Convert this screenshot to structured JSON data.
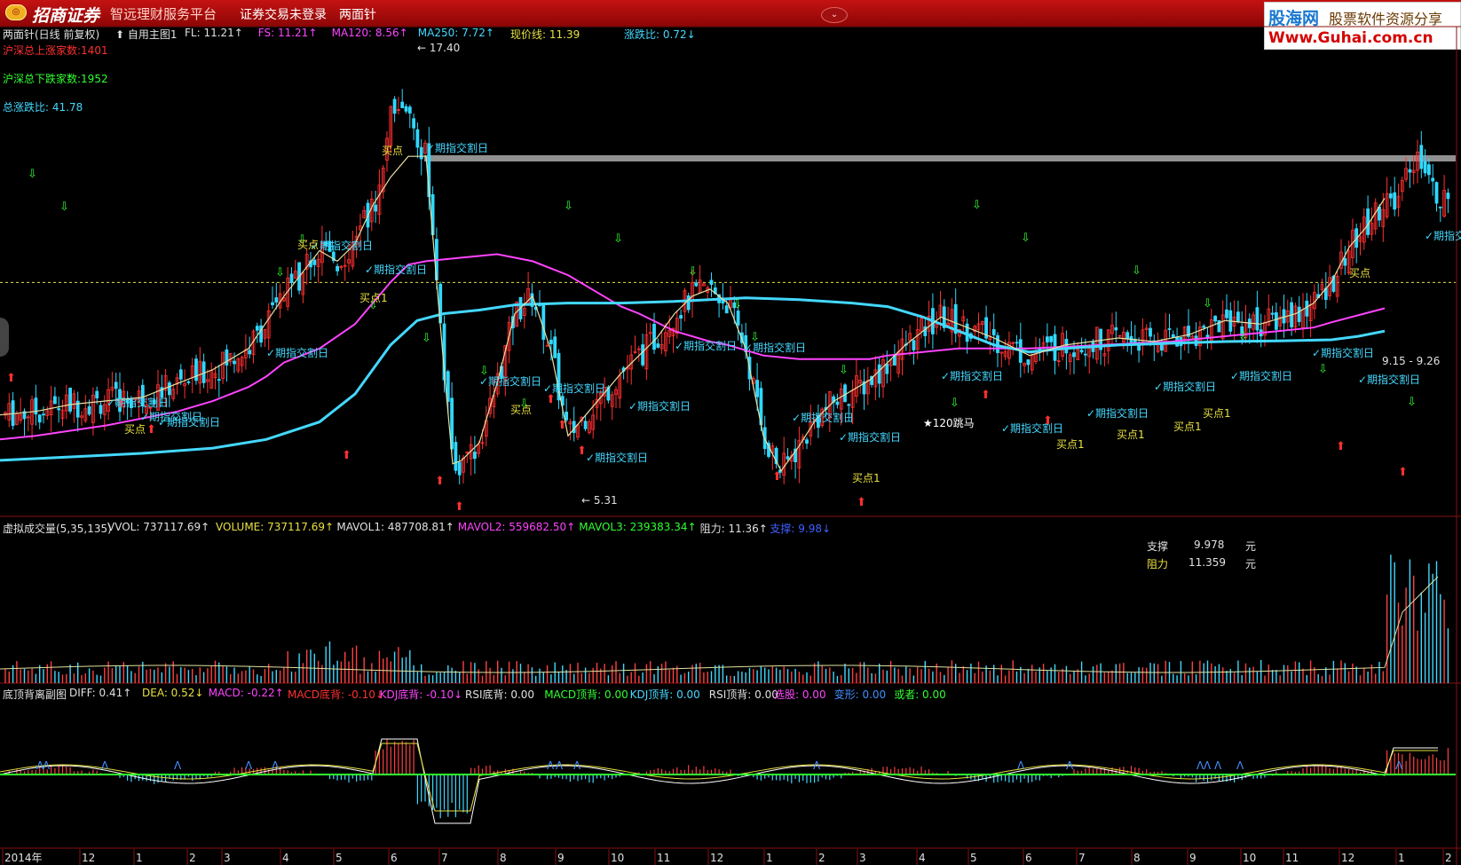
{
  "app": {
    "brand": "招商证券",
    "slogan": "智远理财服务平台",
    "menu": [
      {
        "label": "证券交易未登录"
      },
      {
        "label": "两面针"
      }
    ]
  },
  "ad": {
    "logo": "股海网",
    "slogan": "股票软件资源分享",
    "url": "Www.Guhai.com.cn"
  },
  "main_panel": {
    "title": "两面针(日线 前复权)",
    "template": "自用主图1",
    "indicators": [
      {
        "text": "FL: 11.21",
        "color": "#e0e0e0",
        "arrow": "up"
      },
      {
        "text": "FS: 11.21",
        "color": "#ff44ff",
        "arrow": "up"
      },
      {
        "text": "MA120: 8.56",
        "color": "#ff44ff",
        "arrow": "up"
      },
      {
        "text": "MA250: 7.72",
        "color": "#44d8ff",
        "arrow": "up"
      },
      {
        "text": "现价线: 11.39",
        "color": "#e8e040",
        "arrow": ""
      },
      {
        "text": "涨跌比: 0.72",
        "color": "#44d8ff",
        "arrow": "down"
      }
    ],
    "market_stats": [
      {
        "text": "沪深总上涨家数:1401",
        "color": "#ff3030"
      },
      {
        "text": "沪深总下跌家数:1952",
        "color": "#30ff30"
      },
      {
        "text": "总涨跌比: 41.78",
        "color": "#44d8ff"
      }
    ],
    "annotations": {
      "high_label": "17.40",
      "low_label": "5.31",
      "range_label": "9.15 - 9.26",
      "event_120": "★120跳马",
      "expiry": "期指交割日",
      "buy": "买点",
      "buy1": "买点1"
    }
  },
  "volume_panel": {
    "title": "虚拟成交量(5,35,135)",
    "indicators": [
      {
        "text": "VVOL: 737117.69",
        "color": "#e0e0e0",
        "arrow": "up"
      },
      {
        "text": "VOLUME: 737117.69",
        "color": "#e8e040",
        "arrow": "up"
      },
      {
        "text": "MAVOL1: 487708.81",
        "color": "#e0e0e0",
        "arrow": "up"
      },
      {
        "text": "MAVOL2: 559682.50",
        "color": "#ff44ff",
        "arrow": "up"
      },
      {
        "text": "MAVOL3: 239383.34",
        "color": "#30ff30",
        "arrow": "up"
      },
      {
        "text": "阻力: 11.36",
        "color": "#e0e0e0",
        "arrow": "up"
      },
      {
        "text": "支撑: 9.98",
        "color": "#4060ff",
        "arrow": "down"
      }
    ],
    "support": {
      "label": "支撑",
      "value": "9.978",
      "unit": "元"
    },
    "resistance": {
      "label": "阻力",
      "value": "11.359",
      "unit": "元"
    }
  },
  "macd_panel": {
    "title": "底顶背离副图",
    "indicators": [
      {
        "text": "DIFF: 0.41",
        "color": "#e0e0e0",
        "arrow": "up"
      },
      {
        "text": "DEA: 0.52",
        "color": "#e8e040",
        "arrow": "down"
      },
      {
        "text": "MACD: -0.22",
        "color": "#ff44ff",
        "arrow": "up"
      },
      {
        "text": "MACD底背: -0.10",
        "color": "#ff3030",
        "arrow": "down"
      },
      {
        "text": "KDJ底背: -0.10",
        "color": "#ff44ff",
        "arrow": "down"
      },
      {
        "text": "RSI底背: 0.00",
        "color": "#e0e0e0",
        "arrow": ""
      },
      {
        "text": "MACD顶背: 0.00",
        "color": "#30ff30",
        "arrow": ""
      },
      {
        "text": "KDJ顶背: 0.00",
        "color": "#44d8ff",
        "arrow": ""
      },
      {
        "text": "RSI顶背: 0.00",
        "color": "#e0e0e0",
        "arrow": ""
      }
    ],
    "extra_indicators": [
      {
        "text": "选股: 0.00",
        "color": "#ff44ff"
      },
      {
        "text": "变形: 0.00",
        "color": "#4090ff"
      },
      {
        "text": "或者: 0.00",
        "color": "#30ff30"
      }
    ]
  },
  "time_axis": {
    "labels": [
      "2014年",
      "12",
      "1",
      "2",
      "3",
      "4",
      "5",
      "6",
      "7",
      "8",
      "9",
      "10",
      "11",
      "12",
      "1",
      "2",
      "3",
      "4",
      "5",
      "6",
      "7",
      "8",
      "9",
      "10",
      "11",
      "12",
      "1",
      "2"
    ]
  },
  "chart_data": {
    "type": "candlestick",
    "price_range": [
      4.8,
      18.0
    ],
    "current_price": 11.39,
    "high": 17.4,
    "low": 5.31,
    "series": [
      {
        "name": "MA120",
        "color": "#ff44ff",
        "x": [
          0,
          40,
          80,
          120,
          160,
          200,
          240,
          280,
          300,
          320,
          360,
          400,
          440,
          460,
          480,
          500,
          520,
          540,
          560,
          600,
          640,
          680,
          700,
          720,
          760,
          800,
          820,
          860,
          900,
          940,
          980,
          1000,
          1040,
          1080,
          1100,
          1120,
          1160,
          1200,
          1240,
          1280,
          1320,
          1360,
          1400,
          1440,
          1480,
          1500,
          1530,
          1560
        ],
        "y": [
          6.9,
          7.0,
          7.15,
          7.3,
          7.5,
          7.7,
          8.0,
          8.4,
          8.7,
          9.1,
          9.5,
          10.2,
          11.4,
          11.9,
          12.0,
          12.05,
          12.1,
          12.15,
          12.2,
          12.0,
          11.6,
          11.0,
          10.7,
          10.5,
          10.0,
          9.7,
          9.6,
          9.3,
          9.2,
          9.2,
          9.2,
          9.3,
          9.4,
          9.5,
          9.5,
          9.5,
          9.5,
          9.55,
          9.6,
          9.65,
          9.7,
          9.8,
          9.9,
          10.0,
          10.1,
          10.25,
          10.45,
          10.65
        ]
      },
      {
        "name": "MA250",
        "color": "#44d8ff",
        "x": [
          0,
          80,
          160,
          240,
          300,
          360,
          400,
          440,
          470,
          500,
          540,
          580,
          640,
          700,
          760,
          800,
          840,
          900,
          960,
          1000,
          1040,
          1080,
          1120,
          1160,
          1200,
          1260,
          1320,
          1380,
          1440,
          1500,
          1530,
          1560
        ],
        "y": [
          6.3,
          6.4,
          6.5,
          6.65,
          6.9,
          7.4,
          8.2,
          9.6,
          10.3,
          10.5,
          10.6,
          10.75,
          10.8,
          10.8,
          10.85,
          10.9,
          10.95,
          10.9,
          10.8,
          10.7,
          10.4,
          10.0,
          9.6,
          9.4,
          9.5,
          9.6,
          9.65,
          9.7,
          9.72,
          9.75,
          9.85,
          10.0
        ]
      },
      {
        "name": "FL",
        "color": "#e8e0a0",
        "x": [
          0,
          40,
          80,
          120,
          160,
          200,
          240,
          280,
          320,
          360,
          380,
          400,
          420,
          440,
          460,
          480,
          500,
          510,
          520,
          540,
          560,
          580,
          600,
          620,
          640,
          660,
          700,
          740,
          760,
          780,
          800,
          820,
          840,
          860,
          880,
          900,
          920,
          940,
          980,
          1020,
          1040,
          1060,
          1080,
          1120,
          1160,
          1200,
          1260,
          1300,
          1340,
          1380,
          1420,
          1460,
          1480,
          1500,
          1520,
          1540,
          1560
        ],
        "y": [
          7.6,
          7.7,
          7.9,
          8.0,
          8.1,
          8.5,
          8.9,
          9.5,
          11.0,
          12.3,
          12.0,
          12.5,
          13.6,
          14.4,
          15.0,
          15.0,
          9.0,
          6.2,
          6.3,
          6.8,
          8.5,
          10.5,
          11.0,
          9.5,
          7.0,
          7.6,
          8.8,
          9.8,
          10.5,
          11.0,
          11.2,
          10.8,
          9.5,
          7.0,
          6.0,
          6.7,
          7.5,
          8.0,
          8.6,
          9.6,
          10.0,
          10.4,
          10.2,
          9.8,
          9.3,
          9.6,
          9.8,
          9.7,
          9.9,
          10.3,
          10.2,
          10.5,
          10.8,
          11.4,
          12.4,
          13.0,
          13.8
        ]
      }
    ]
  }
}
